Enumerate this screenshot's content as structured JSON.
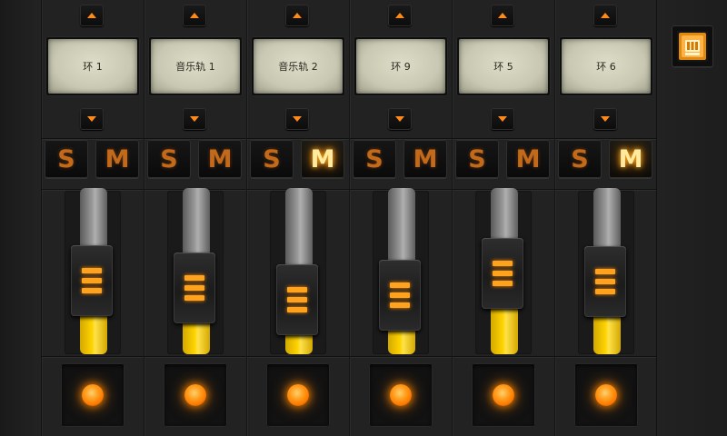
{
  "accent_color": "#ff8a1c",
  "fill_color": "#ffd400",
  "menu_icon": "mixer-menu-icon",
  "channels": [
    {
      "name": "环 1",
      "solo_label": "S",
      "mute_label": "M",
      "solo_on": false,
      "mute_on": false,
      "level": 0.38
    },
    {
      "name": "音乐轨 1",
      "solo_label": "S",
      "mute_label": "M",
      "solo_on": false,
      "mute_on": false,
      "level": 0.3
    },
    {
      "name": "音乐轨 2",
      "solo_label": "S",
      "mute_label": "M",
      "solo_on": false,
      "mute_on": true,
      "level": 0.18
    },
    {
      "name": "环 9",
      "solo_label": "S",
      "mute_label": "M",
      "solo_on": false,
      "mute_on": false,
      "level": 0.23
    },
    {
      "name": "环 5",
      "solo_label": "S",
      "mute_label": "M",
      "solo_on": false,
      "mute_on": false,
      "level": 0.46
    },
    {
      "name": "环 6",
      "solo_label": "S",
      "mute_label": "M",
      "solo_on": false,
      "mute_on": true,
      "level": 0.37
    }
  ]
}
